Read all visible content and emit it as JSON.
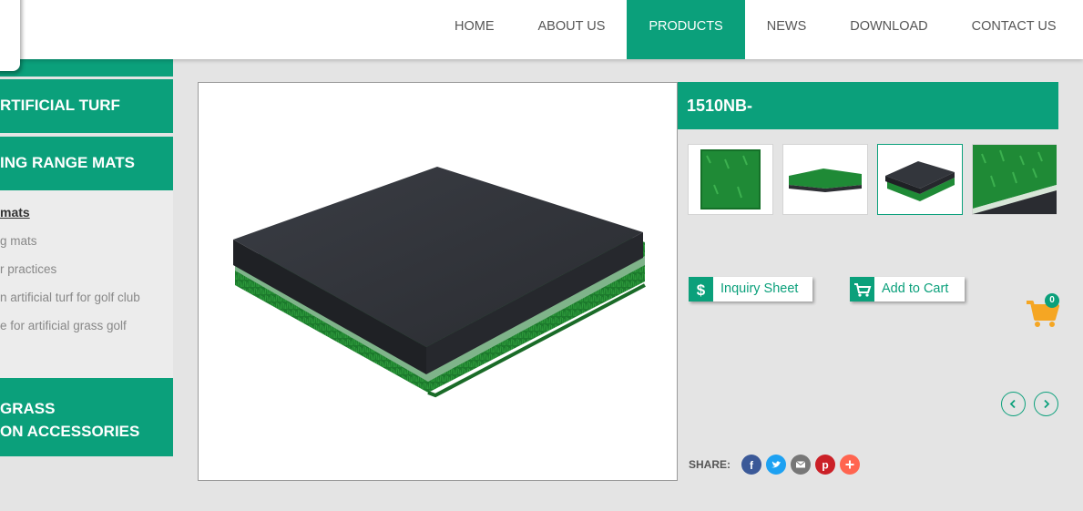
{
  "nav": {
    "items": [
      {
        "label": "HOME"
      },
      {
        "label": "ABOUT US"
      },
      {
        "label": "PRODUCTS"
      },
      {
        "label": "NEWS"
      },
      {
        "label": "DOWNLOAD"
      },
      {
        "label": "CONTACT US"
      }
    ],
    "active": "PRODUCTS"
  },
  "sidebar": {
    "categories": [
      {
        "label": "RTIFICIAL TURF"
      },
      {
        "label": "ING RANGE MATS"
      }
    ],
    "sub_items": [
      {
        "label": " mats",
        "current": true
      },
      {
        "label": "g mats"
      },
      {
        "label": "r practices"
      },
      {
        "label": "n artificial turf for golf club"
      },
      {
        "label": "e for artificial grass golf"
      }
    ],
    "bottom_category": {
      "line1": " GRASS",
      "line2": "ON ACCESSORIES"
    }
  },
  "product": {
    "title": "1510NB-",
    "selected_thumbnail": 3,
    "thumbnails": [
      {
        "icon": "turf-square-thumb"
      },
      {
        "icon": "mat-side-thumb"
      },
      {
        "icon": "mat-top-thumb"
      },
      {
        "icon": "turf-closeup-thumb"
      }
    ]
  },
  "actions": {
    "inquiry_label": "Inquiry Sheet",
    "inquiry_icon": "dollar-icon",
    "cart_label": "Add to Cart",
    "cart_icon": "cart-icon"
  },
  "cart": {
    "count": "0"
  },
  "share": {
    "label": "SHARE:",
    "networks": [
      {
        "name": "facebook",
        "color": "#3b5998"
      },
      {
        "name": "twitter",
        "color": "#1da1f2"
      },
      {
        "name": "email",
        "color": "#777777"
      },
      {
        "name": "pinterest",
        "color": "#cb2027"
      },
      {
        "name": "more",
        "color": "#ff6550"
      }
    ]
  },
  "colors": {
    "accent": "#0ba07b",
    "background": "#e4e4e4",
    "cart_orange": "#f5a623"
  }
}
